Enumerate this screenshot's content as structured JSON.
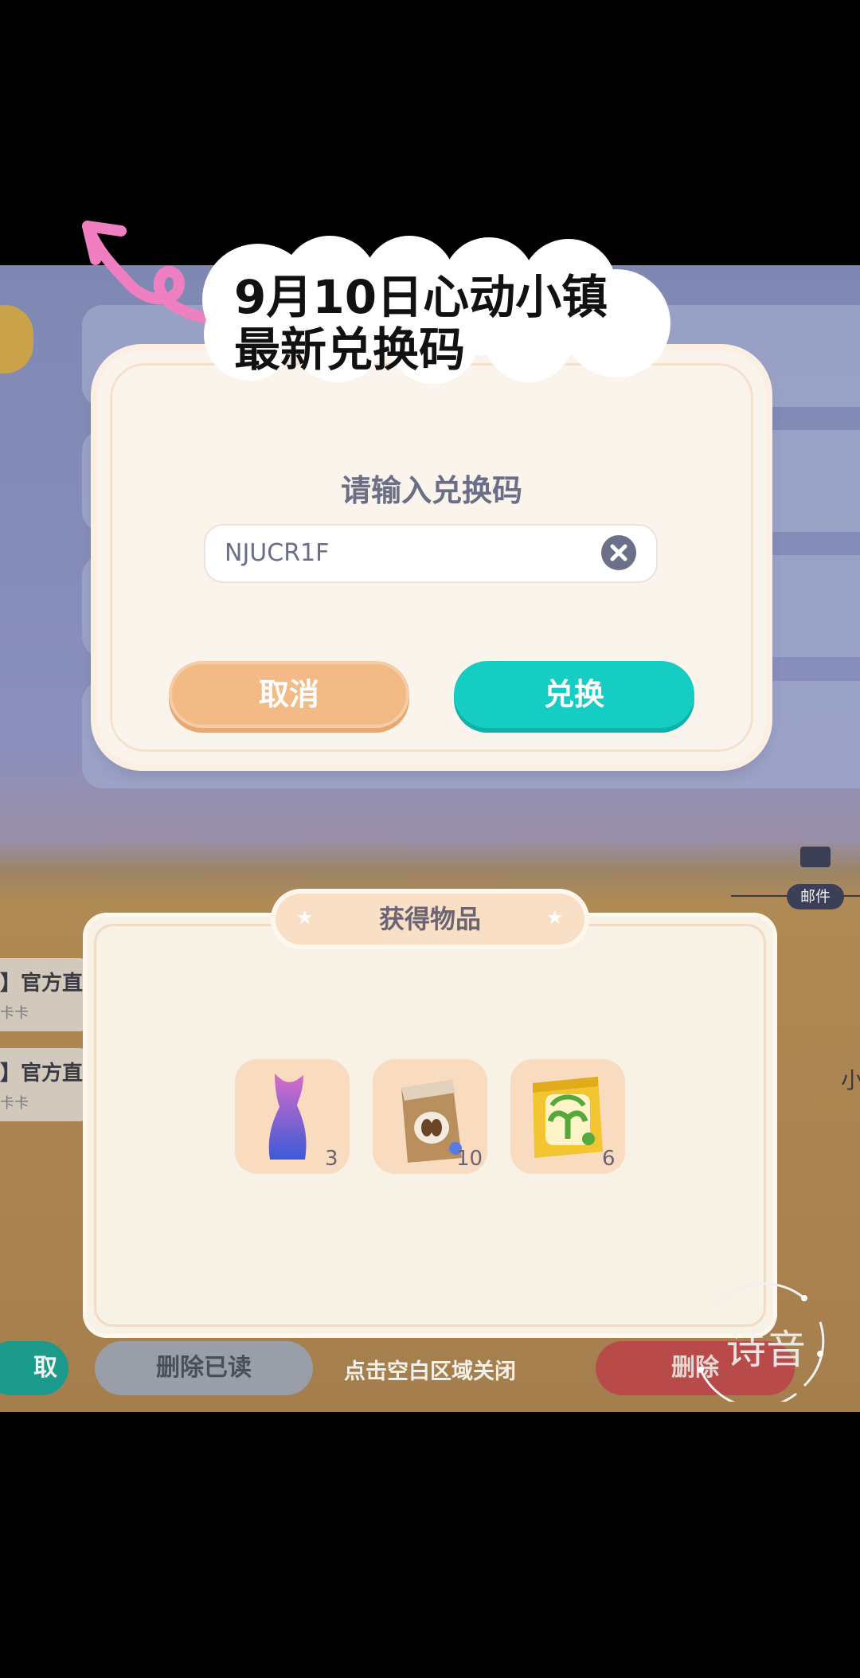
{
  "overlay": {
    "caption_line1": "9月10日心动小镇",
    "caption_line2": "最新兑换码"
  },
  "dialog": {
    "title": "请输入兑换码",
    "code_value": "NJUCR1F",
    "cancel_label": "取消",
    "redeem_label": "兑换"
  },
  "background": {
    "mail_label": "邮件",
    "list_items": [
      {
        "title": "】官方直",
        "sub": "卡卡"
      },
      {
        "title": "】官方直",
        "sub": "卡卡"
      }
    ],
    "side_text": "小"
  },
  "items_panel": {
    "title": "获得物品",
    "items": [
      {
        "icon": "mermaid-tail-icon",
        "count": "3"
      },
      {
        "icon": "coffee-bean-bag-icon",
        "count": "10"
      },
      {
        "icon": "plant-fertilizer-bag-icon",
        "count": "6"
      }
    ]
  },
  "bottom_bar": {
    "left_button": "取",
    "delete_read_label": "删除已读",
    "close_hint": "点击空白区域关闭",
    "delete_label": "删除"
  },
  "watermark": {
    "text": "诗音"
  },
  "colors": {
    "redeem": "#16cdc4",
    "cancel": "#f2bb86",
    "panel": "#fbf4ec"
  }
}
